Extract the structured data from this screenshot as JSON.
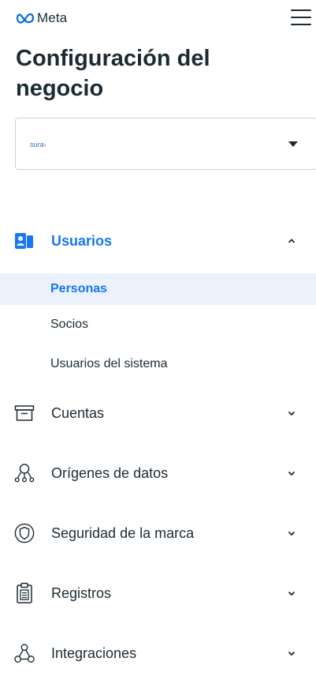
{
  "header": {
    "brand": "Meta",
    "title": "Configuración del negocio"
  },
  "business_selector": {
    "logo_text": "sura",
    "logo_mark": "›"
  },
  "nav": {
    "sections": [
      {
        "label": "Usuarios",
        "icon": "users-icon",
        "expanded": true,
        "active": true
      },
      {
        "label": "Cuentas",
        "icon": "inbox-tray-icon",
        "expanded": false
      },
      {
        "label": "Orígenes de datos",
        "icon": "people-network-icon",
        "expanded": false
      },
      {
        "label": "Seguridad de la marca",
        "icon": "shield-icon",
        "expanded": false
      },
      {
        "label": "Registros",
        "icon": "clipboard-icon",
        "expanded": false
      },
      {
        "label": "Integraciones",
        "icon": "integrations-icon",
        "expanded": false
      }
    ],
    "users_subitems": [
      {
        "label": "Personas",
        "selected": true
      },
      {
        "label": "Socios",
        "selected": false
      },
      {
        "label": "Usuarios del sistema",
        "selected": false
      }
    ]
  },
  "colors": {
    "accent": "#1877f2",
    "selected_bg": "#ebf2fc",
    "text": "#1c2b33"
  }
}
